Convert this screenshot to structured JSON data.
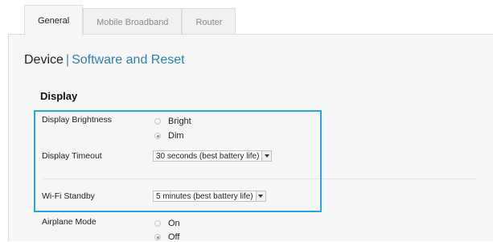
{
  "tabs": [
    {
      "label": "General",
      "active": true
    },
    {
      "label": "Mobile Broadband",
      "active": false
    },
    {
      "label": "Router",
      "active": false
    }
  ],
  "heading": {
    "current": "Device",
    "separator": "|",
    "link": "Software and Reset"
  },
  "section": {
    "title": "Display"
  },
  "settings": {
    "brightness": {
      "label": "Display Brightness",
      "options": [
        "Bright",
        "Dim"
      ],
      "selected": "Dim"
    },
    "timeout": {
      "label": "Display Timeout",
      "value": "30 seconds (best battery life)"
    },
    "wifi_standby": {
      "label": "Wi-Fi Standby",
      "value": "5 minutes (best battery life)"
    },
    "airplane": {
      "label": "Airplane Mode",
      "options": [
        "On",
        "Off"
      ],
      "selected": "Off"
    }
  },
  "colors": {
    "accent_link": "#2d7fb8",
    "highlight_border": "#29a6e2",
    "panel_bg": "#f6f6f6"
  }
}
